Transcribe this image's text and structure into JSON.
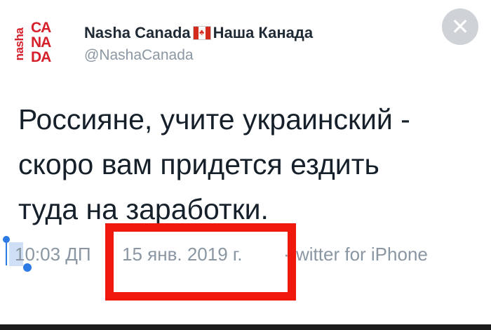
{
  "account": {
    "logo_vertical_text": "nasha",
    "logo_rows": [
      "CA",
      "NA",
      "DA"
    ],
    "display_name_part1": "Nasha Canada",
    "flag_icon": "canada-flag-icon",
    "display_name_part2": "Наша Канада",
    "handle": "@NashaCanada"
  },
  "close_button": {
    "icon": "close-icon",
    "glyph": "✕"
  },
  "tweet": {
    "lines": [
      "Россияне, учите украинский -",
      "скоро вам придется ездить",
      "туда на заработки."
    ],
    "time": "10:03 ДП",
    "date": "15 янв. 2019 г.",
    "separator": "·",
    "source": "witter for iPhone"
  },
  "colors": {
    "logo_red": "#d51f2a",
    "highlight_red": "#f0170b",
    "meta_gray": "#8a96a2",
    "selection_blue": "#2c7be5"
  }
}
